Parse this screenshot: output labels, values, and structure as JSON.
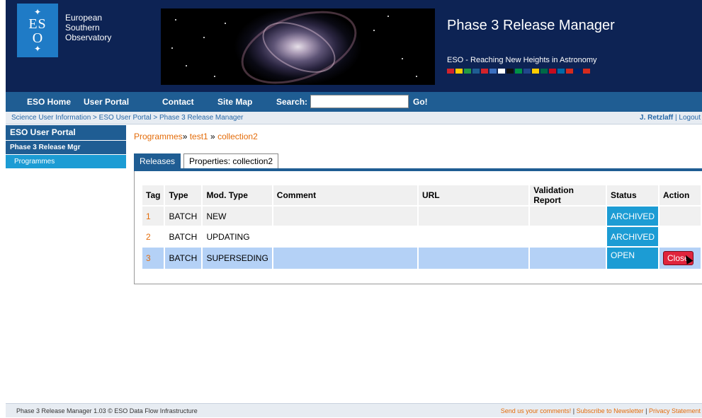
{
  "header": {
    "org_line1": "European",
    "org_line2": "Southern",
    "org_line3": "Observatory",
    "logo_text": "ES",
    "logo_o": "O",
    "title": "Phase 3 Release Manager",
    "tagline": "ESO - Reaching New Heights in Astronomy",
    "flag_colors": [
      "#d3232b",
      "#ffcc00",
      "#229944",
      "#1f5d93",
      "#d3232b",
      "#3b6fbf",
      "#ffffff",
      "#111111",
      "#009246",
      "#21468b",
      "#ffcc00",
      "#006847",
      "#c60b1e",
      "#006aa7",
      "#d52b1e",
      "#012169",
      "#d52b1e"
    ]
  },
  "nav": {
    "eso_home": "ESO Home",
    "user_portal": "User Portal",
    "contact": "Contact",
    "site_map": "Site Map",
    "search_label": "Search:",
    "search_value": "",
    "go": "Go!"
  },
  "breadcrumb": {
    "path": "Science User Information > ESO User Portal > Phase 3 Release Manager",
    "user": "J. Retzlaff",
    "sep": " | ",
    "logout": "Logout"
  },
  "sidebar": {
    "heading": "ESO User Portal",
    "subheading": "Phase 3 Release Mgr",
    "item": "Programmes"
  },
  "main": {
    "crumb_programmes": "Programmes",
    "crumb_sep1": "» ",
    "crumb_test": "test1",
    "crumb_sep2": " » ",
    "crumb_collection": "collection2",
    "tabs": [
      "Releases",
      "Properties: collection2"
    ],
    "columns": [
      "Tag",
      "Type",
      "Mod. Type",
      "Comment",
      "URL",
      "Validation Report",
      "Status",
      "Action"
    ],
    "rows": [
      {
        "tag": "1",
        "type": "BATCH",
        "mod": "NEW",
        "comment": "",
        "url": "",
        "report": "",
        "status": "ARCHIVED",
        "action": ""
      },
      {
        "tag": "2",
        "type": "BATCH",
        "mod": "UPDATING",
        "comment": "",
        "url": "",
        "report": "",
        "status": "ARCHIVED",
        "action": ""
      },
      {
        "tag": "3",
        "type": "BATCH",
        "mod": "SUPERSEDING",
        "comment": "",
        "url": "",
        "report": "",
        "status": "OPEN",
        "action": "Close"
      }
    ]
  },
  "footer": {
    "left": "Phase 3 Release Manager 1.03 © ESO Data Flow Infrastructure",
    "comments": "Send us your comments!",
    "newsletter": "Subscribe to Newsletter",
    "privacy": "Privacy Statement",
    "sep": " | "
  }
}
